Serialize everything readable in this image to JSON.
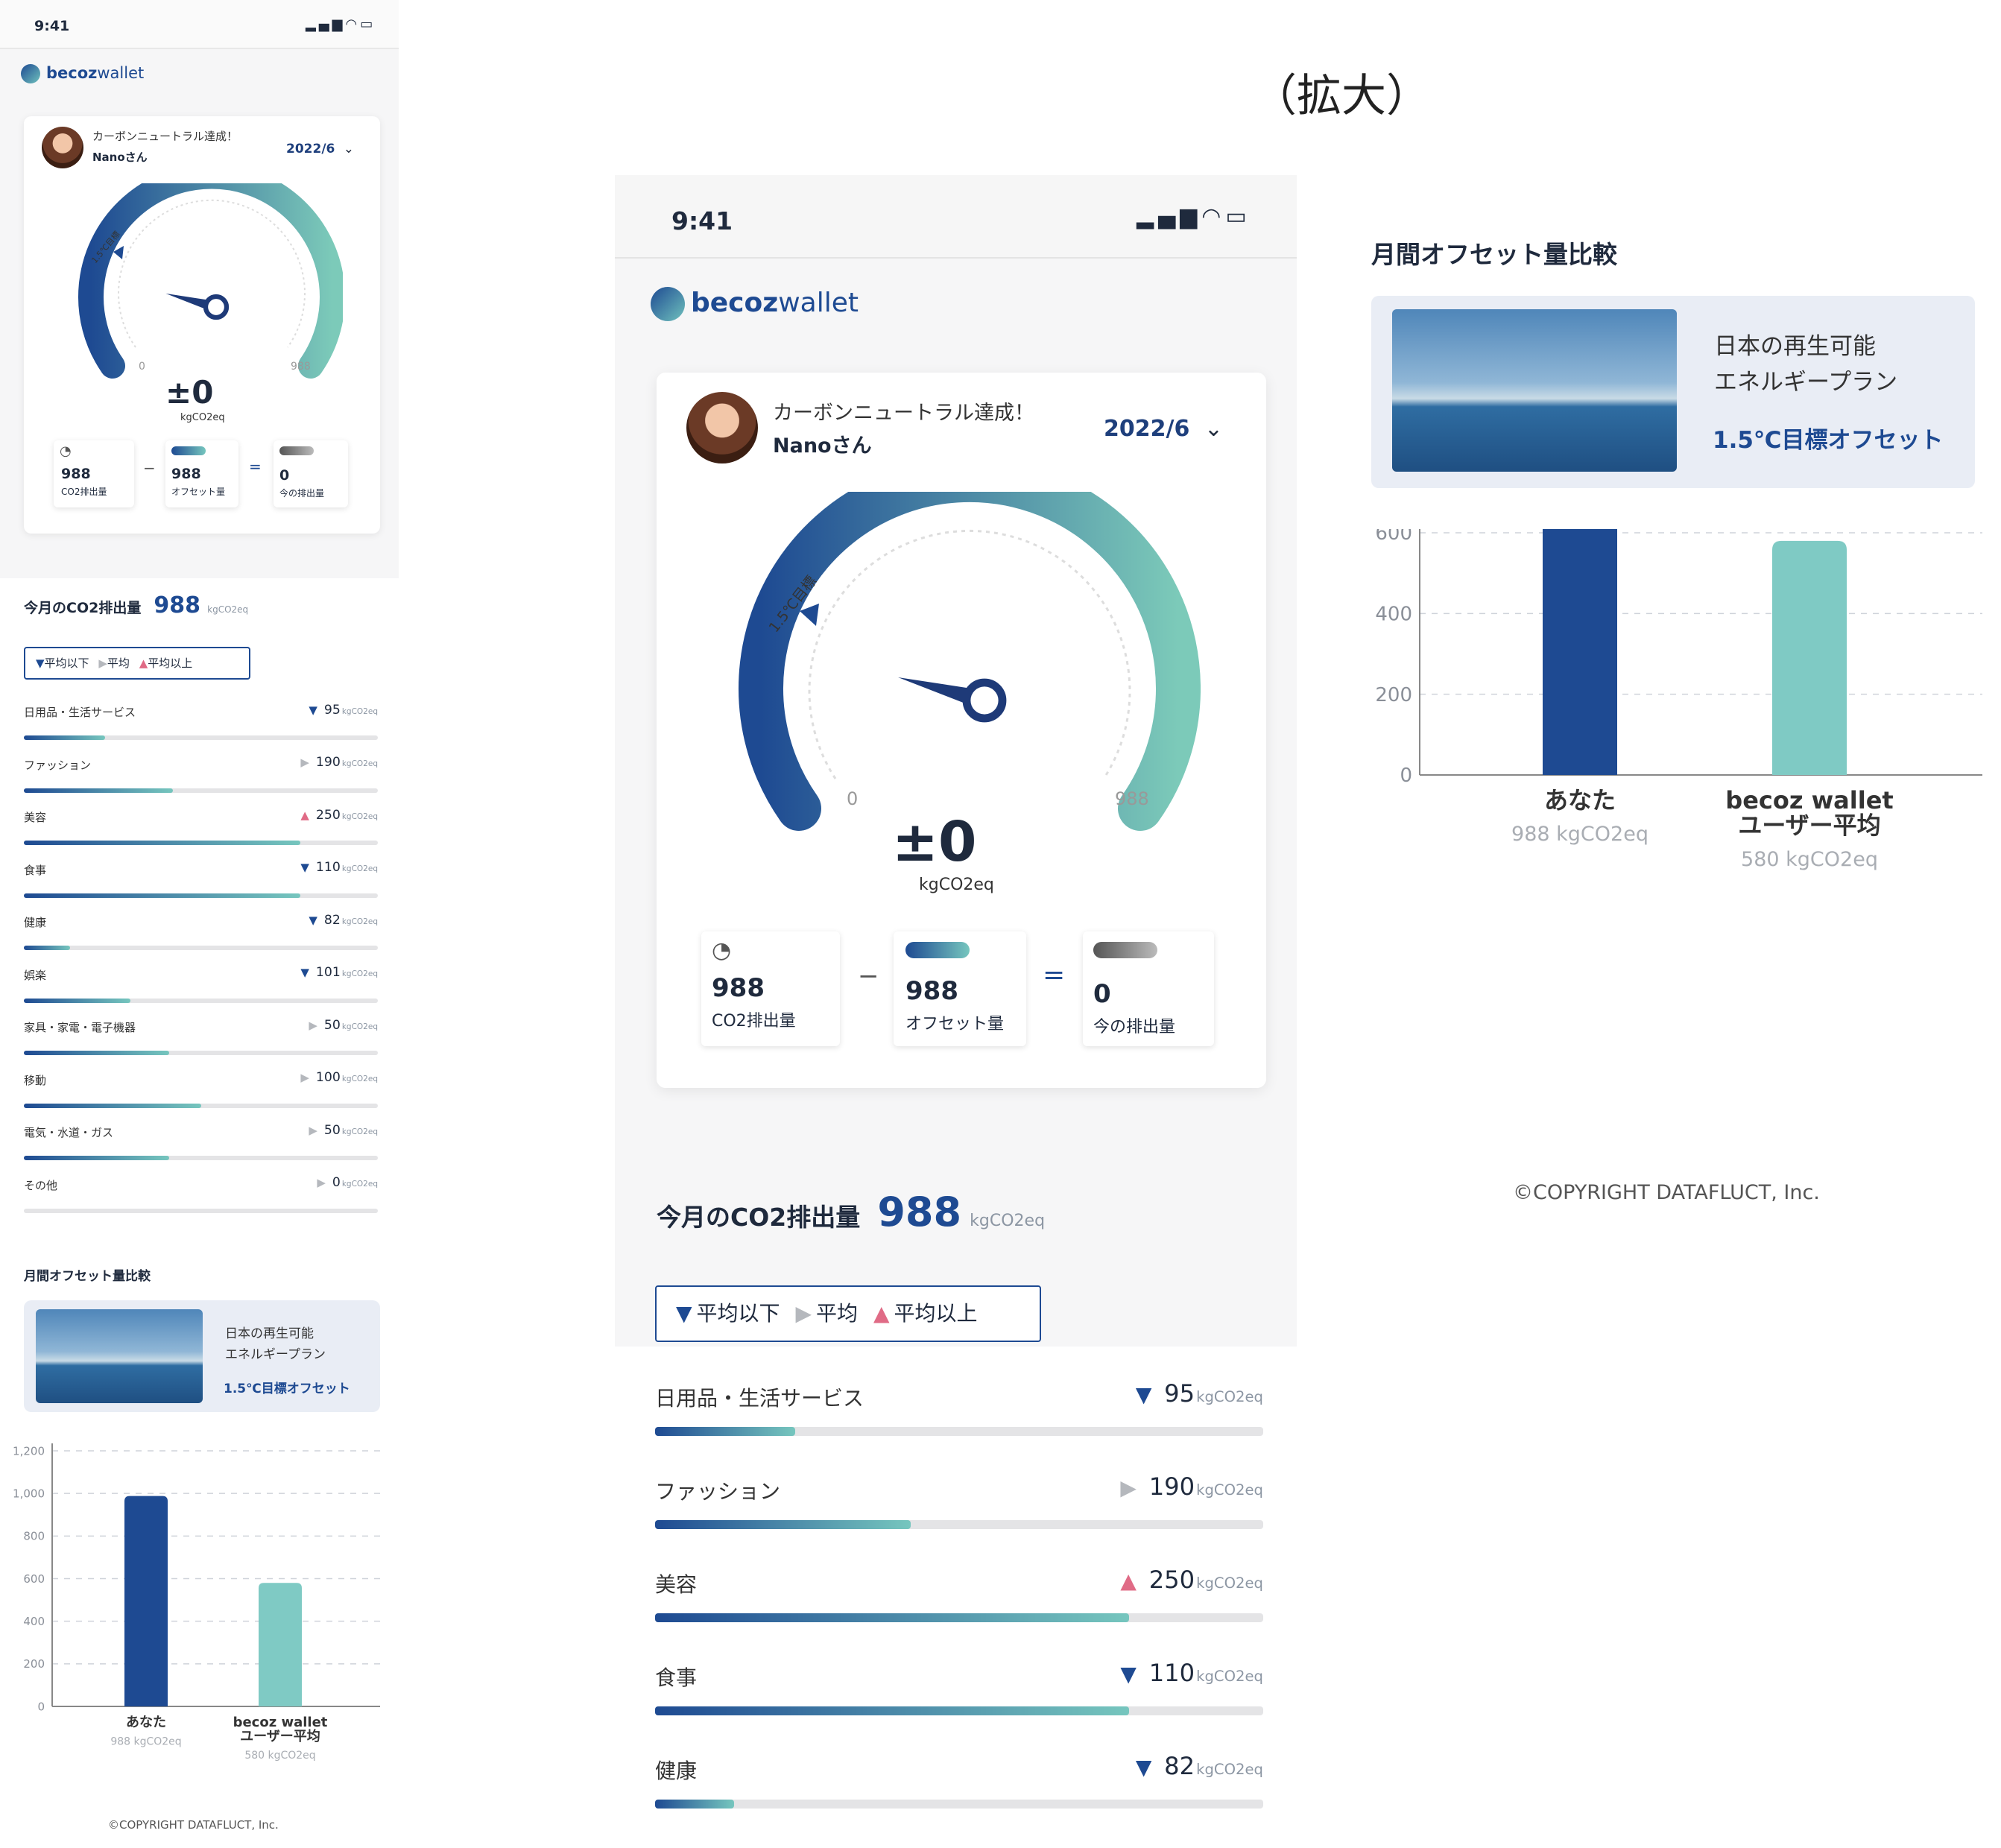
{
  "header_title": "（拡大）",
  "status": {
    "time": "9:41"
  },
  "brand": {
    "name_bold": "becoz",
    "name_light": "wallet"
  },
  "summary": {
    "message": "カーボンニュートラル達成！",
    "user": "Nanoさん",
    "period": "2022/6",
    "gauge": {
      "target_label": "1.5℃目標",
      "min_label": "0",
      "max_label": "988",
      "value": "±0",
      "unit": "kgCO2eq",
      "needle_fraction": 0.2
    }
  },
  "equation": {
    "emission": {
      "value": "988",
      "label": "CO2排出量"
    },
    "minus": "−",
    "offset": {
      "value": "988",
      "label": "オフセット量"
    },
    "equals": "=",
    "current": {
      "value": "0",
      "label": "今の排出量"
    }
  },
  "monthly": {
    "title": "今月のCO2排出量",
    "value": "988",
    "unit": "kgCO2eq"
  },
  "legend": {
    "below": "平均以下",
    "average": "平均",
    "above": "平均以上"
  },
  "categories": [
    {
      "name": "日用品・生活サービス",
      "trend": "below",
      "value": "95",
      "unit": "kgCO2eq",
      "fill": 0.23
    },
    {
      "name": "ファッション",
      "trend": "average",
      "value": "190",
      "unit": "kgCO2eq",
      "fill": 0.42
    },
    {
      "name": "美容",
      "trend": "above",
      "value": "250",
      "unit": "kgCO2eq",
      "fill": 0.78
    },
    {
      "name": "食事",
      "trend": "below",
      "value": "110",
      "unit": "kgCO2eq",
      "fill": 0.78
    },
    {
      "name": "健康",
      "trend": "below",
      "value": "82",
      "unit": "kgCO2eq",
      "fill": 0.13
    },
    {
      "name": "娯楽",
      "trend": "below",
      "value": "101",
      "unit": "kgCO2eq",
      "fill": 0.3
    },
    {
      "name": "家具・家電・電子機器",
      "trend": "average",
      "value": "50",
      "unit": "kgCO2eq",
      "fill": 0.41
    },
    {
      "name": "移動",
      "trend": "average",
      "value": "100",
      "unit": "kgCO2eq",
      "fill": 0.5
    },
    {
      "name": "電気・水道・ガス",
      "trend": "average",
      "value": "50",
      "unit": "kgCO2eq",
      "fill": 0.41
    },
    {
      "name": "その他",
      "trend": "average",
      "value": "0",
      "unit": "kgCO2eq",
      "fill": 0.0
    }
  ],
  "offset_compare": {
    "title": "月間オフセット量比較",
    "plan_line1": "日本の再生可能",
    "plan_line2": "エネルギープラン",
    "plan_tag": "1.5℃目標オフセット"
  },
  "chart_data": {
    "type": "bar",
    "categories": [
      "あなた",
      "becoz wallet ユーザー平均"
    ],
    "category_lines": [
      [
        "あなた"
      ],
      [
        "becoz wallet",
        "ユーザー平均"
      ]
    ],
    "sublabels": [
      "988 kgCO2eq",
      "580 kgCO2eq"
    ],
    "values": [
      988,
      580
    ],
    "colors": [
      "#1e4a92",
      "#7fcac4"
    ],
    "ylim": [
      0,
      1200
    ],
    "yticks": [
      0,
      200,
      400,
      600,
      800,
      1000,
      1200
    ],
    "ytick_labels": [
      "0",
      "200",
      "400",
      "600",
      "800",
      "1,000",
      "1,200"
    ],
    "grid": true
  },
  "copyright": "©COPYRIGHT DATAFLUCT, Inc."
}
